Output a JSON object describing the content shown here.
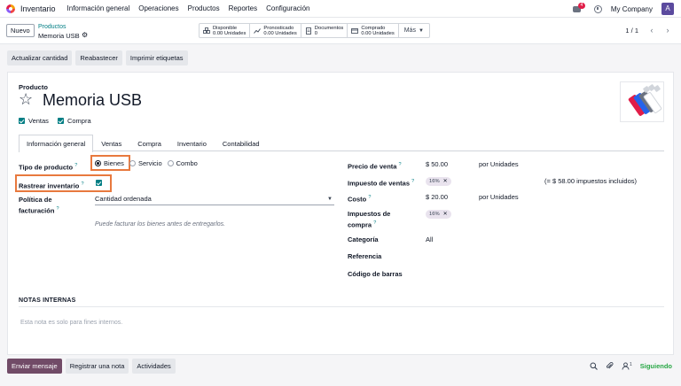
{
  "navbar": {
    "app_name": "Inventario",
    "menu": [
      "Información general",
      "Operaciones",
      "Productos",
      "Reportes",
      "Configuración"
    ],
    "messages_badge": "4",
    "company": "My Company",
    "avatar_letter": "A"
  },
  "control": {
    "new_label": "Nuevo",
    "breadcrumb_parent": "Productos",
    "breadcrumb_current": "Memoria USB",
    "stats": [
      {
        "label": "Disponible",
        "value": "0.00 Unidades",
        "icon": "boxes-icon"
      },
      {
        "label": "Pronosticado",
        "value": "0.00 Unidades",
        "icon": "forecast-chart-icon"
      },
      {
        "label": "Documentos",
        "value": "0",
        "icon": "document-icon"
      },
      {
        "label": "Comprado",
        "value": "0.00 Unidades",
        "icon": "credit-card-icon"
      }
    ],
    "more_label": "Más",
    "pager": "1 / 1"
  },
  "actions": [
    "Actualizar cantidad",
    "Reabastecer",
    "Imprimir etiquetas"
  ],
  "form": {
    "product_label": "Producto",
    "product_name": "Memoria USB",
    "sales_label": "Ventas",
    "purchase_label": "Compra",
    "tabs": [
      "Información general",
      "Ventas",
      "Compra",
      "Inventario",
      "Contabilidad"
    ],
    "active_tab": "Información general",
    "product_type_label": "Tipo de producto",
    "product_type_options": [
      "Bienes",
      "Servicio",
      "Combo"
    ],
    "product_type_selected": "Bienes",
    "track_inventory_label": "Rastrear inventario",
    "invoicing_policy_label": "Política de facturación",
    "invoicing_policy_value": "Cantidad ordenada",
    "invoicing_hint": "Puede facturar los bienes antes de entregarlos.",
    "sale_price_label": "Precio de venta",
    "sale_price_value": "$ 50.00",
    "sale_price_unit": "por Unidades",
    "sales_tax_label": "Impuesto de ventas",
    "sales_tax_tag": "16%",
    "sales_tax_note": "(= $ 58.00 impuestos incluidos)",
    "cost_label": "Costo",
    "cost_value": "$ 20.00",
    "cost_unit": "por Unidades",
    "purchase_tax_label_1": "Impuestos de",
    "purchase_tax_label_2": "compra",
    "purchase_tax_tag": "16%",
    "category_label": "Categoría",
    "category_value": "All",
    "reference_label": "Referencia",
    "barcode_label": "Código de barras",
    "notes_title": "NOTAS INTERNAS",
    "notes_placeholder": "Esta nota es solo para fines internos."
  },
  "chatter": {
    "buttons": [
      "Enviar mensaje",
      "Registrar una nota",
      "Actividades"
    ],
    "followers_count": "1",
    "following_label": "Siguiendo"
  },
  "colors": {
    "accent": "#017e84",
    "primary_button": "#714b67",
    "highlight": "#e8793e",
    "following": "#28a745"
  }
}
